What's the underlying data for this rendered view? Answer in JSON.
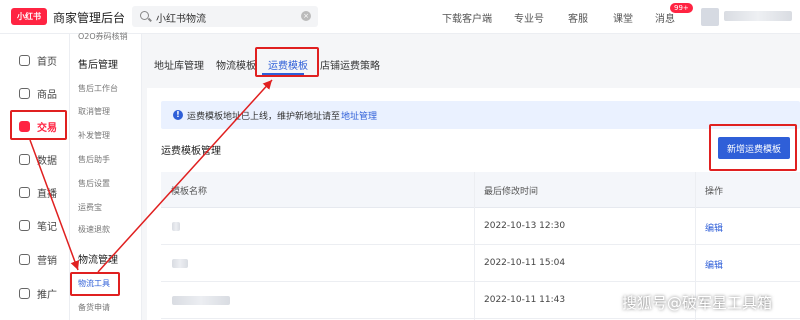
{
  "header": {
    "logo_text": "小红书",
    "brand": "商家管理后台",
    "search_value": "小红书物流",
    "nav": [
      "下载客户端",
      "专业号",
      "客服",
      "课堂",
      "消息"
    ],
    "message_badge": "99+"
  },
  "rail": {
    "items": [
      {
        "label": "首页",
        "icon": "home-icon"
      },
      {
        "label": "商品",
        "icon": "product-icon"
      },
      {
        "label": "交易",
        "icon": "trade-icon"
      },
      {
        "label": "数据",
        "icon": "data-icon"
      },
      {
        "label": "直播",
        "icon": "live-icon"
      },
      {
        "label": "笔记",
        "icon": "notes-icon"
      },
      {
        "label": "营销",
        "icon": "marketing-icon"
      },
      {
        "label": "推广",
        "icon": "promote-icon"
      }
    ]
  },
  "submenu": {
    "top_cut": "O2O券码核销",
    "group1": "售后管理",
    "group1_items": [
      "售后工作台",
      "取消管理",
      "补发管理",
      "售后助手",
      "售后设置",
      "运费宝",
      "极速退款"
    ],
    "group2": "物流管理",
    "group2_items": [
      "物流工具",
      "备货申请"
    ]
  },
  "tabs": [
    "地址库管理",
    "物流模板",
    "运费模板",
    "店铺运费策略"
  ],
  "notice": {
    "text": "运费模板地址已上线，维护新地址请至",
    "link": "地址管理"
  },
  "section_title": "运费模板管理",
  "add_button": "新增运费模板",
  "table": {
    "headers": [
      "模板名称",
      "最后修改时间",
      "操作"
    ],
    "rows": [
      {
        "time": "2022-10-13 12:30",
        "action": "编辑"
      },
      {
        "time": "2022-10-11 15:04",
        "action": "编辑"
      },
      {
        "time": "2022-10-11 11:43",
        "action": ""
      }
    ]
  },
  "watermark": "搜狐号@破军星工具箱",
  "colors": {
    "brand": "#ff2442",
    "accent": "#2f5fd8",
    "annotation": "#e02020"
  }
}
